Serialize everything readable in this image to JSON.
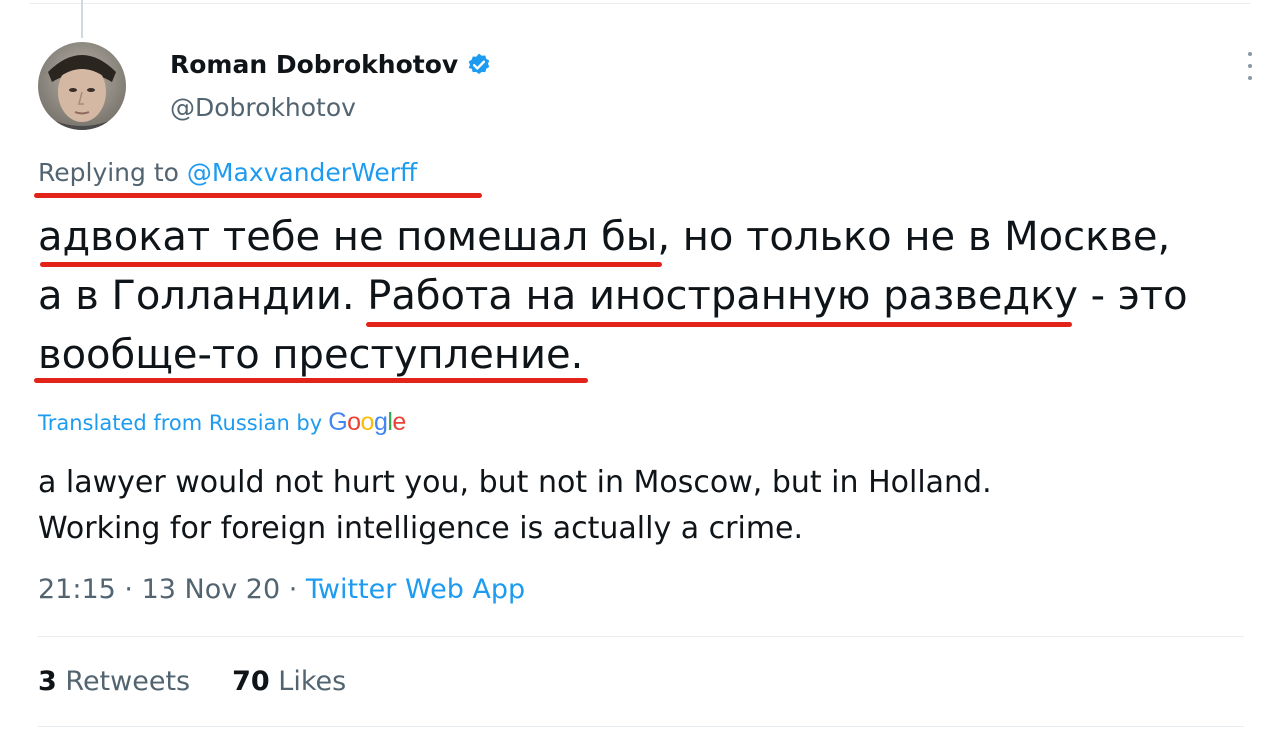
{
  "author": {
    "display_name": "Roman Dobrokhotov",
    "handle": "@Dobrokhotov",
    "verified_icon": "verified-badge-icon"
  },
  "reply": {
    "prefix": "Replying to ",
    "mention": "@MaxvanderWerff"
  },
  "tweet": {
    "lines": [
      "адвокат тебе не помешал бы, но только не в Москве,",
      "а в Голландии. Работа на иностранную разведку - это",
      "вообще-то преступление."
    ]
  },
  "translation": {
    "label": "Translated from Russian by",
    "provider": "Google",
    "text_line1": "a lawyer would not hurt you, but not in Moscow, but in Holland.",
    "text_line2": "Working for foreign intelligence is actually a crime."
  },
  "meta": {
    "time": "21:15",
    "date": "13 Nov 20",
    "separator": " · ",
    "source": "Twitter Web App"
  },
  "stats": {
    "retweets_count": "3",
    "retweets_label": "Retweets",
    "likes_count": "70",
    "likes_label": "Likes"
  },
  "colors": {
    "link": "#1d9bf0",
    "secondary_text": "#536471",
    "highlight_underline": "#e2231a"
  }
}
